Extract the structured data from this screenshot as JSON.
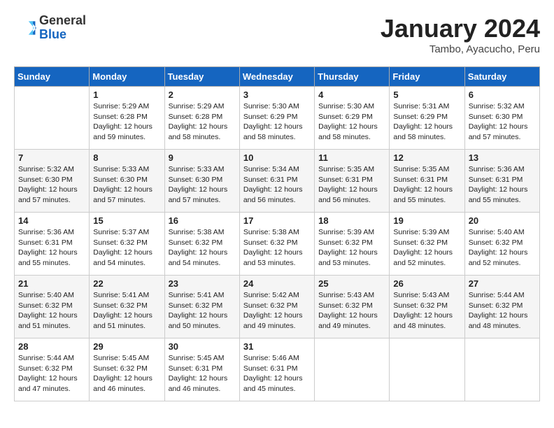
{
  "header": {
    "logo_general": "General",
    "logo_blue": "Blue",
    "month_title": "January 2024",
    "location": "Tambo, Ayacucho, Peru"
  },
  "weekdays": [
    "Sunday",
    "Monday",
    "Tuesday",
    "Wednesday",
    "Thursday",
    "Friday",
    "Saturday"
  ],
  "weeks": [
    [
      {
        "day": "",
        "info": ""
      },
      {
        "day": "1",
        "info": "Sunrise: 5:29 AM\nSunset: 6:28 PM\nDaylight: 12 hours\nand 59 minutes."
      },
      {
        "day": "2",
        "info": "Sunrise: 5:29 AM\nSunset: 6:28 PM\nDaylight: 12 hours\nand 58 minutes."
      },
      {
        "day": "3",
        "info": "Sunrise: 5:30 AM\nSunset: 6:29 PM\nDaylight: 12 hours\nand 58 minutes."
      },
      {
        "day": "4",
        "info": "Sunrise: 5:30 AM\nSunset: 6:29 PM\nDaylight: 12 hours\nand 58 minutes."
      },
      {
        "day": "5",
        "info": "Sunrise: 5:31 AM\nSunset: 6:29 PM\nDaylight: 12 hours\nand 58 minutes."
      },
      {
        "day": "6",
        "info": "Sunrise: 5:32 AM\nSunset: 6:30 PM\nDaylight: 12 hours\nand 57 minutes."
      }
    ],
    [
      {
        "day": "7",
        "info": "Sunrise: 5:32 AM\nSunset: 6:30 PM\nDaylight: 12 hours\nand 57 minutes."
      },
      {
        "day": "8",
        "info": "Sunrise: 5:33 AM\nSunset: 6:30 PM\nDaylight: 12 hours\nand 57 minutes."
      },
      {
        "day": "9",
        "info": "Sunrise: 5:33 AM\nSunset: 6:30 PM\nDaylight: 12 hours\nand 57 minutes."
      },
      {
        "day": "10",
        "info": "Sunrise: 5:34 AM\nSunset: 6:31 PM\nDaylight: 12 hours\nand 56 minutes."
      },
      {
        "day": "11",
        "info": "Sunrise: 5:35 AM\nSunset: 6:31 PM\nDaylight: 12 hours\nand 56 minutes."
      },
      {
        "day": "12",
        "info": "Sunrise: 5:35 AM\nSunset: 6:31 PM\nDaylight: 12 hours\nand 55 minutes."
      },
      {
        "day": "13",
        "info": "Sunrise: 5:36 AM\nSunset: 6:31 PM\nDaylight: 12 hours\nand 55 minutes."
      }
    ],
    [
      {
        "day": "14",
        "info": "Sunrise: 5:36 AM\nSunset: 6:31 PM\nDaylight: 12 hours\nand 55 minutes."
      },
      {
        "day": "15",
        "info": "Sunrise: 5:37 AM\nSunset: 6:32 PM\nDaylight: 12 hours\nand 54 minutes."
      },
      {
        "day": "16",
        "info": "Sunrise: 5:38 AM\nSunset: 6:32 PM\nDaylight: 12 hours\nand 54 minutes."
      },
      {
        "day": "17",
        "info": "Sunrise: 5:38 AM\nSunset: 6:32 PM\nDaylight: 12 hours\nand 53 minutes."
      },
      {
        "day": "18",
        "info": "Sunrise: 5:39 AM\nSunset: 6:32 PM\nDaylight: 12 hours\nand 53 minutes."
      },
      {
        "day": "19",
        "info": "Sunrise: 5:39 AM\nSunset: 6:32 PM\nDaylight: 12 hours\nand 52 minutes."
      },
      {
        "day": "20",
        "info": "Sunrise: 5:40 AM\nSunset: 6:32 PM\nDaylight: 12 hours\nand 52 minutes."
      }
    ],
    [
      {
        "day": "21",
        "info": "Sunrise: 5:40 AM\nSunset: 6:32 PM\nDaylight: 12 hours\nand 51 minutes."
      },
      {
        "day": "22",
        "info": "Sunrise: 5:41 AM\nSunset: 6:32 PM\nDaylight: 12 hours\nand 51 minutes."
      },
      {
        "day": "23",
        "info": "Sunrise: 5:41 AM\nSunset: 6:32 PM\nDaylight: 12 hours\nand 50 minutes."
      },
      {
        "day": "24",
        "info": "Sunrise: 5:42 AM\nSunset: 6:32 PM\nDaylight: 12 hours\nand 49 minutes."
      },
      {
        "day": "25",
        "info": "Sunrise: 5:43 AM\nSunset: 6:32 PM\nDaylight: 12 hours\nand 49 minutes."
      },
      {
        "day": "26",
        "info": "Sunrise: 5:43 AM\nSunset: 6:32 PM\nDaylight: 12 hours\nand 48 minutes."
      },
      {
        "day": "27",
        "info": "Sunrise: 5:44 AM\nSunset: 6:32 PM\nDaylight: 12 hours\nand 48 minutes."
      }
    ],
    [
      {
        "day": "28",
        "info": "Sunrise: 5:44 AM\nSunset: 6:32 PM\nDaylight: 12 hours\nand 47 minutes."
      },
      {
        "day": "29",
        "info": "Sunrise: 5:45 AM\nSunset: 6:32 PM\nDaylight: 12 hours\nand 46 minutes."
      },
      {
        "day": "30",
        "info": "Sunrise: 5:45 AM\nSunset: 6:31 PM\nDaylight: 12 hours\nand 46 minutes."
      },
      {
        "day": "31",
        "info": "Sunrise: 5:46 AM\nSunset: 6:31 PM\nDaylight: 12 hours\nand 45 minutes."
      },
      {
        "day": "",
        "info": ""
      },
      {
        "day": "",
        "info": ""
      },
      {
        "day": "",
        "info": ""
      }
    ]
  ]
}
